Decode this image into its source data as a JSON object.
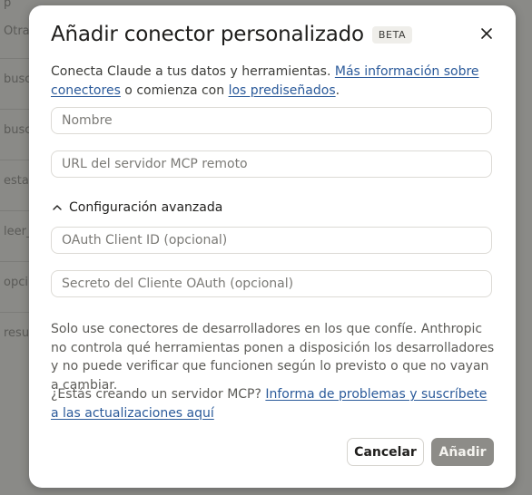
{
  "background": {
    "items": [
      "Otra",
      "busc",
      "busc",
      "esta",
      "leer_",
      "opci",
      "resu"
    ]
  },
  "modal": {
    "title": "Añadir conector personalizado",
    "badge": "BETA",
    "close_icon": "close-icon",
    "intro": {
      "text_before": "Conecta Claude a tus datos y herramientas. ",
      "link_more_info": "Más información sobre conectores",
      "text_middle": " o comienza con ",
      "link_prebuilt": "los prediseñados",
      "text_after": "."
    },
    "fields": {
      "name": {
        "value": "",
        "placeholder": "Nombre"
      },
      "server_url": {
        "value": "",
        "placeholder": "URL del servidor MCP remoto"
      },
      "client_id": {
        "value": "",
        "placeholder": "OAuth Client ID (opcional)"
      },
      "client_secret": {
        "value": "",
        "placeholder": "Secreto del Cliente OAuth (opcional)"
      }
    },
    "advanced": {
      "label": "Configuración avanzada",
      "icon": "chevron-up-icon",
      "expanded": true
    },
    "disclaimer": "Solo use conectores de desarrolladores en los que confíe. Anthropic no controla qué herramientas ponen a disposición los desarrolladores y no puede verificar que funcionen según lo previsto o que no vayan a cambiar.",
    "mcp_note": {
      "text": "¿Estás creando un servidor MCP? ",
      "link": "Informa de problemas y suscríbete a las actualizaciones aquí"
    },
    "buttons": {
      "cancel": "Cancelar",
      "add": "Añadir"
    }
  },
  "colors": {
    "overlay": "#8a8a87",
    "link": "#2b5a9a",
    "primary_disabled": "#8d8c88"
  }
}
